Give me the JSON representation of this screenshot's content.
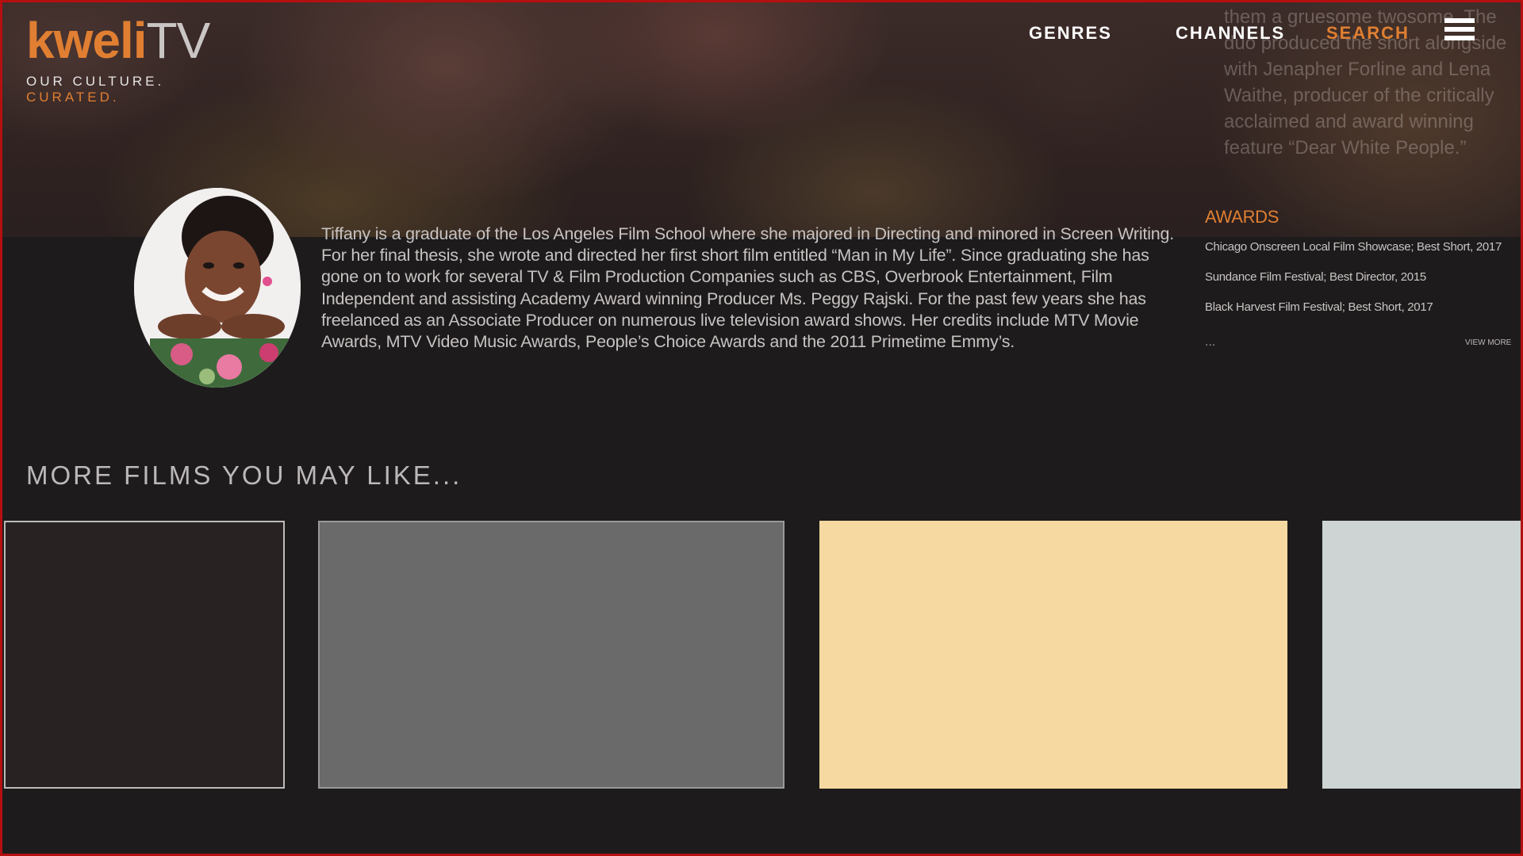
{
  "brand": {
    "name_part1": "kweli",
    "name_part2": "TV",
    "tagline_line1": "OUR CULTURE.",
    "tagline_line2": "CURATED.",
    "accent_color": "#e07f32"
  },
  "nav": {
    "items": [
      {
        "label": "GENRES"
      },
      {
        "label": "CHANNELS"
      },
      {
        "label": "SEARCH"
      }
    ],
    "menu_icon": "hamburger-menu-icon"
  },
  "faded_bio_text": "them a gruesome twosome. The duo produced the short alongside with Jenapher Forline and Lena Waithe, producer of the critically acclaimed and award winning feature “Dear White People.”",
  "profile": {
    "avatar_icon": "profile-photo",
    "bio": "Tiffany is a graduate of the Los Angeles Film School where she majored in Directing and minored in Screen Writing. For her final thesis, she wrote and directed her first short film entitled “Man in My Life”.  Since graduating she has gone on to work for several TV & Film Production Companies such as CBS, Overbrook Entertainment, Film Independent and assisting Academy Award winning Producer Ms. Peggy Rajski.  For the past few years she has freelanced as an Associate Producer on numerous live television award shows. Her credits include MTV Movie Awards, MTV Video Music Awards, People’s Choice Awards and the 2011 Primetime Emmy’s."
  },
  "awards": {
    "title": "AWARDS",
    "items": [
      "Chicago Onscreen Local Film Showcase; Best Short, 2017",
      "Sundance Film Festival; Best Director, 2015",
      "Black Harvest Film Festival; Best Short, 2017"
    ],
    "ellipsis": "...",
    "view_more": "VIEW MORE"
  },
  "more_films": {
    "title": "MORE FILMS YOU MAY LIKE...",
    "cards": [
      {
        "color": "#282222"
      },
      {
        "color": "#6a6a6a"
      },
      {
        "color": "#f6d9a0"
      },
      {
        "color": "#cdd4d3"
      }
    ]
  }
}
